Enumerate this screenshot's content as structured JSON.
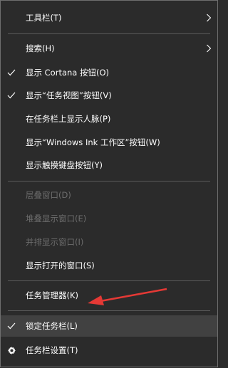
{
  "menu": {
    "toolbars": "工具栏(T)",
    "search": "搜索(H)",
    "show_cortana": "显示 Cortana 按钮(O)",
    "show_task_view": "显示“任务视图”按钮(V)",
    "show_people": "在任务栏上显示人脉(P)",
    "show_windows_ink": "显示“Windows Ink 工作区”按钮(W)",
    "show_touch_keyboard": "显示触摸键盘按钮(Y)",
    "cascade_windows": "层叠窗口(D)",
    "stack_windows": "堆叠显示窗口(E)",
    "side_by_side": "并排显示窗口(I)",
    "show_open_windows": "显示打开的窗口(S)",
    "task_manager": "任务管理器(K)",
    "lock_taskbar": "锁定任务栏(L)",
    "taskbar_settings": "任务栏设置(T)"
  },
  "icons": {
    "check": "checkmark-icon",
    "submenu": "chevron-right-icon",
    "settings": "gear-icon"
  },
  "colors": {
    "background": "#2b2b2b",
    "highlight": "#414141",
    "text": "#ffffff",
    "disabled_text": "#6d6d6d",
    "annotation_arrow": "#e53935"
  }
}
